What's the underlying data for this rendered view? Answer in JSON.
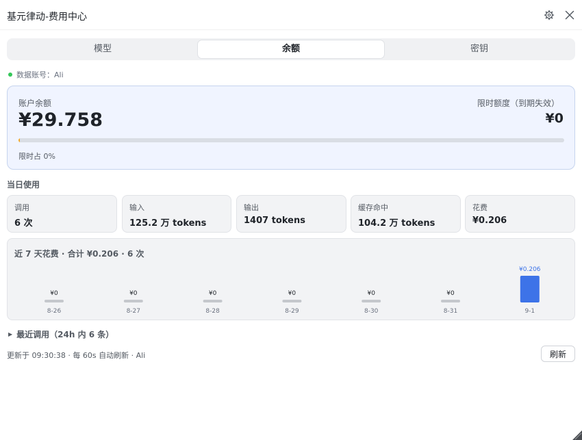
{
  "window": {
    "title": "基元律动-费用中心",
    "settings_icon": "gear-icon",
    "close_icon": "close-icon"
  },
  "tabs": [
    {
      "label": "模型",
      "active": false
    },
    {
      "label": "余额",
      "active": true
    },
    {
      "label": "密钥",
      "active": false
    }
  ],
  "account": {
    "text": "数据账号：Ali",
    "status_color": "#34c759"
  },
  "balance": {
    "label": "账户余额",
    "value": "¥29.758",
    "limit_label": "限时额度（到期失效）",
    "limit_value": "¥0",
    "ratio_text": "限时占 0%",
    "ratio_fraction": 0.003,
    "accent_color": "#f5a623"
  },
  "today": {
    "title": "当日使用",
    "stats": [
      {
        "label": "调用",
        "value": "6 次"
      },
      {
        "label": "输入",
        "value": "125.2 万 tokens"
      },
      {
        "label": "输出",
        "value": "1407 tokens"
      },
      {
        "label": "缓存命中",
        "value": "104.2 万 tokens"
      },
      {
        "label": "花费",
        "value": "¥0.206"
      }
    ]
  },
  "chart_data": {
    "type": "bar",
    "title": "近 7 天花费 · 合计 ¥0.206 · 6 次",
    "categories": [
      "8-26",
      "8-27",
      "8-28",
      "8-29",
      "8-30",
      "8-31",
      "9-1"
    ],
    "values": [
      0,
      0,
      0,
      0,
      0,
      0,
      0.206
    ],
    "labels": [
      "¥0",
      "¥0",
      "¥0",
      "¥0",
      "¥0",
      "¥0",
      "¥0.206"
    ],
    "ylim": [
      0,
      0.206
    ],
    "bar_color": "#3d73e8",
    "zero_color": "#c4c7cc",
    "highlight_label_color": "#3d73e8"
  },
  "recent": {
    "label": "最近调用（24h 内 6 条）",
    "caret_icon": "caret-right-icon"
  },
  "footer": {
    "text": "更新于 09:30:38 · 每 60s 自动刷新 · Ali",
    "refresh_label": "刷新"
  }
}
